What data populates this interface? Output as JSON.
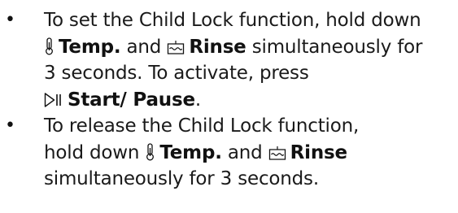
{
  "bullet_symbol": "•",
  "items": [
    {
      "line1": "To set the Child Lock function, hold down",
      "temp_label": "Temp.",
      "and": "and",
      "rinse_label": "Rinse",
      "line2_tail": "simultaneously for",
      "line3": "3 seconds. To activate, press",
      "start_label": "Start/ Pause",
      "end_punct": "."
    },
    {
      "line1": "To release the Child Lock function,",
      "line2_head": "hold down",
      "temp_label": "Temp.",
      "and": "and",
      "rinse_label": "Rinse",
      "line3": "simultaneously for 3 seconds."
    }
  ],
  "icons": {
    "temp": "thermometer-icon",
    "rinse": "rinse-basin-icon",
    "start_pause": "play-pause-icon"
  }
}
